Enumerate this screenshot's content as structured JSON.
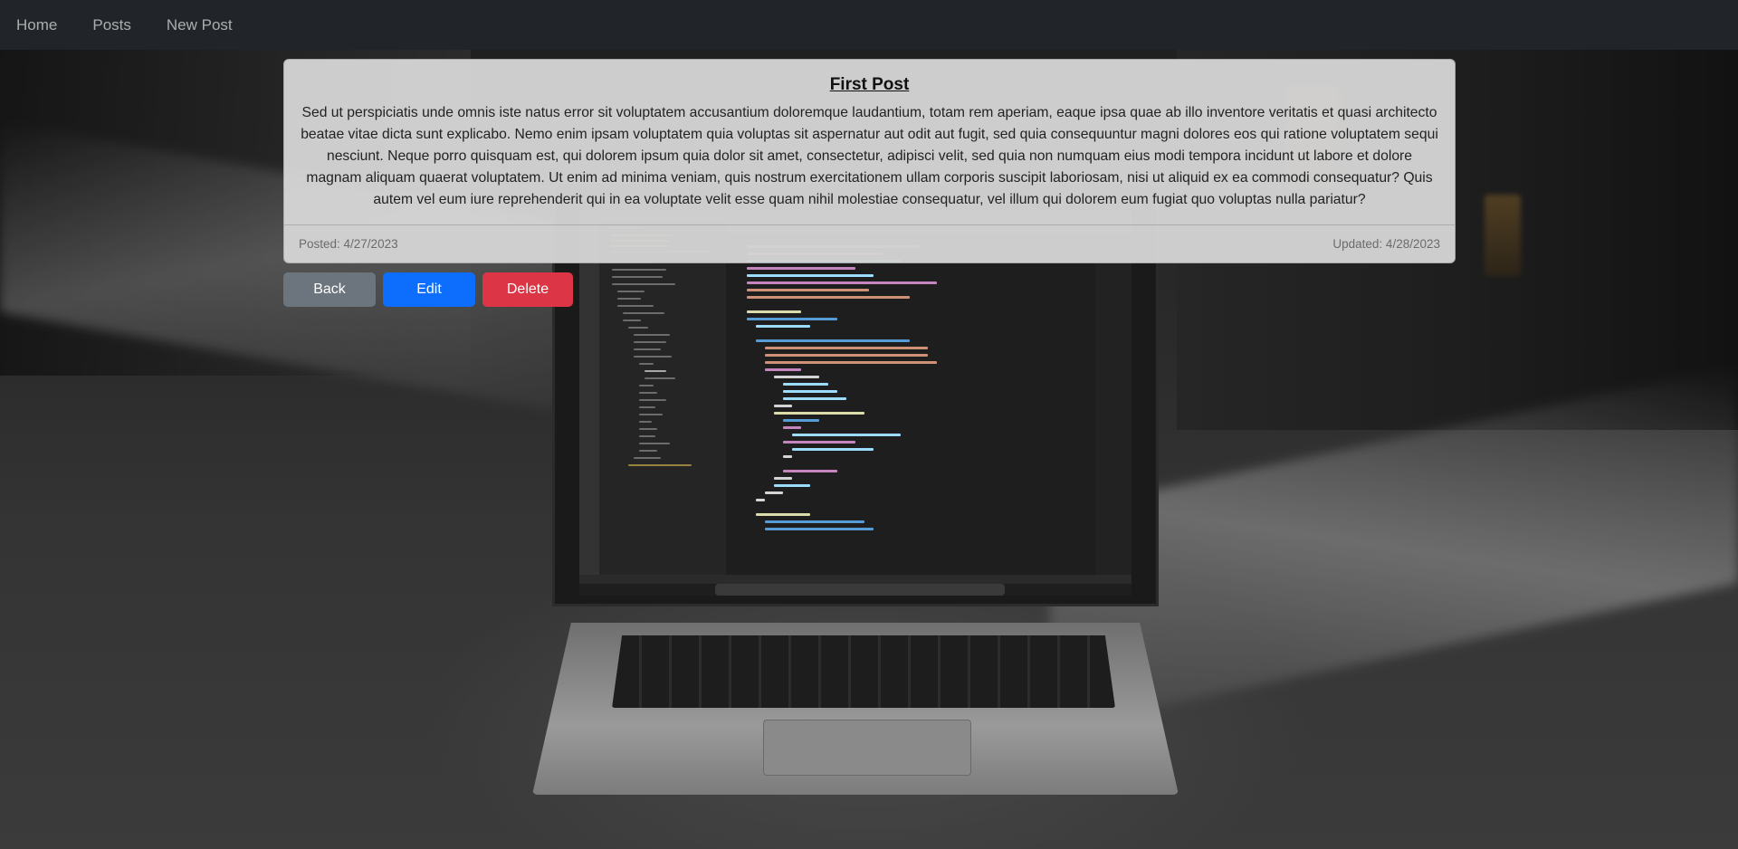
{
  "navbar": {
    "links": [
      {
        "label": "Home"
      },
      {
        "label": "Posts"
      },
      {
        "label": "New Post"
      }
    ]
  },
  "post": {
    "title": "First Post",
    "body": "Sed ut perspiciatis unde omnis iste natus error sit voluptatem accusantium doloremque laudantium, totam rem aperiam, eaque ipsa quae ab illo inventore veritatis et quasi architecto beatae vitae dicta sunt explicabo. Nemo enim ipsam voluptatem quia voluptas sit aspernatur aut odit aut fugit, sed quia consequuntur magni dolores eos qui ratione voluptatem sequi nesciunt. Neque porro quisquam est, qui dolorem ipsum quia dolor sit amet, consectetur, adipisci velit, sed quia non numquam eius modi tempora incidunt ut labore et dolore magnam aliquam quaerat voluptatem. Ut enim ad minima veniam, quis nostrum exercitationem ullam corporis suscipit laboriosam, nisi ut aliquid ex ea commodi consequatur? Quis autem vel eum iure reprehenderit qui in ea voluptate velit esse quam nihil molestiae consequatur, vel illum qui dolorem eum fugiat quo voluptas nulla pariatur?",
    "posted": "Posted: 4/27/2023",
    "updated": "Updated: 4/28/2023"
  },
  "actions": {
    "back_label": "Back",
    "edit_label": "Edit",
    "delete_label": "Delete"
  },
  "colors": {
    "navbar_bg": "#212529",
    "btn_back": "#6c757d",
    "btn_edit": "#0d6efd",
    "btn_delete": "#dc3545"
  },
  "background": {
    "image_subject": "laptop-with-code-editor"
  }
}
